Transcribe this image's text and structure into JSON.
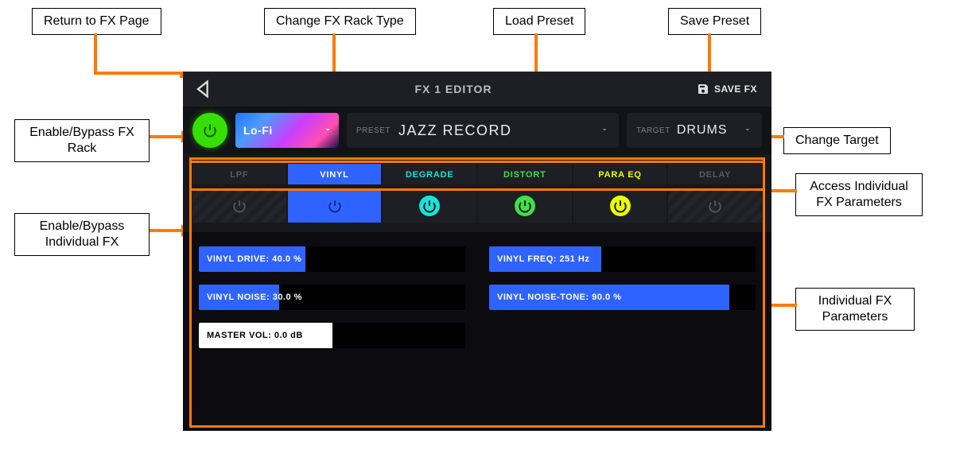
{
  "annotations": {
    "return_fx": "Return to FX Page",
    "change_rack": "Change FX Rack Type",
    "load_preset": "Load Preset",
    "save_preset": "Save Preset",
    "enable_rack": "Enable/Bypass FX Rack",
    "change_target": "Change Target",
    "enable_indiv": "Enable/Bypass Individual FX",
    "access_indiv": "Access Individual FX Parameters",
    "indiv_params": "Individual FX Parameters"
  },
  "header": {
    "title": "FX 1 EDITOR",
    "save_label": "SAVE FX"
  },
  "rack": {
    "type_label": "Lo-Fi",
    "preset_label": "PRESET",
    "preset_value": "JAZZ RECORD",
    "target_label": "TARGET",
    "target_value": "DRUMS"
  },
  "tabs": [
    {
      "label": "LPF",
      "color": "dim",
      "active": false,
      "enabled": false
    },
    {
      "label": "VINYL",
      "color": "white",
      "active": true,
      "enabled": true
    },
    {
      "label": "DEGRADE",
      "color": "teal",
      "active": false,
      "enabled": true,
      "pwr_color": "#16e4d8"
    },
    {
      "label": "DISTORT",
      "color": "green",
      "active": false,
      "enabled": true,
      "pwr_color": "#3fe04a"
    },
    {
      "label": "PARA EQ",
      "color": "yellow",
      "active": false,
      "enabled": true,
      "pwr_color": "#eaff00"
    },
    {
      "label": "DELAY",
      "color": "dim",
      "active": false,
      "enabled": false
    }
  ],
  "params": [
    {
      "label": "VINYL DRIVE: 40.0 %",
      "pct": 40,
      "style": "blue"
    },
    {
      "label": "VINYL FREQ: 251 Hz",
      "pct": 42,
      "style": "blue"
    },
    {
      "label": "VINYL NOISE: 30.0 %",
      "pct": 30,
      "style": "blue"
    },
    {
      "label": "VINYL NOISE-TONE: 90.0 %",
      "pct": 90,
      "style": "blue"
    },
    {
      "label": "MASTER VOL: 0.0 dB",
      "pct": 50,
      "style": "white",
      "half": true
    }
  ]
}
